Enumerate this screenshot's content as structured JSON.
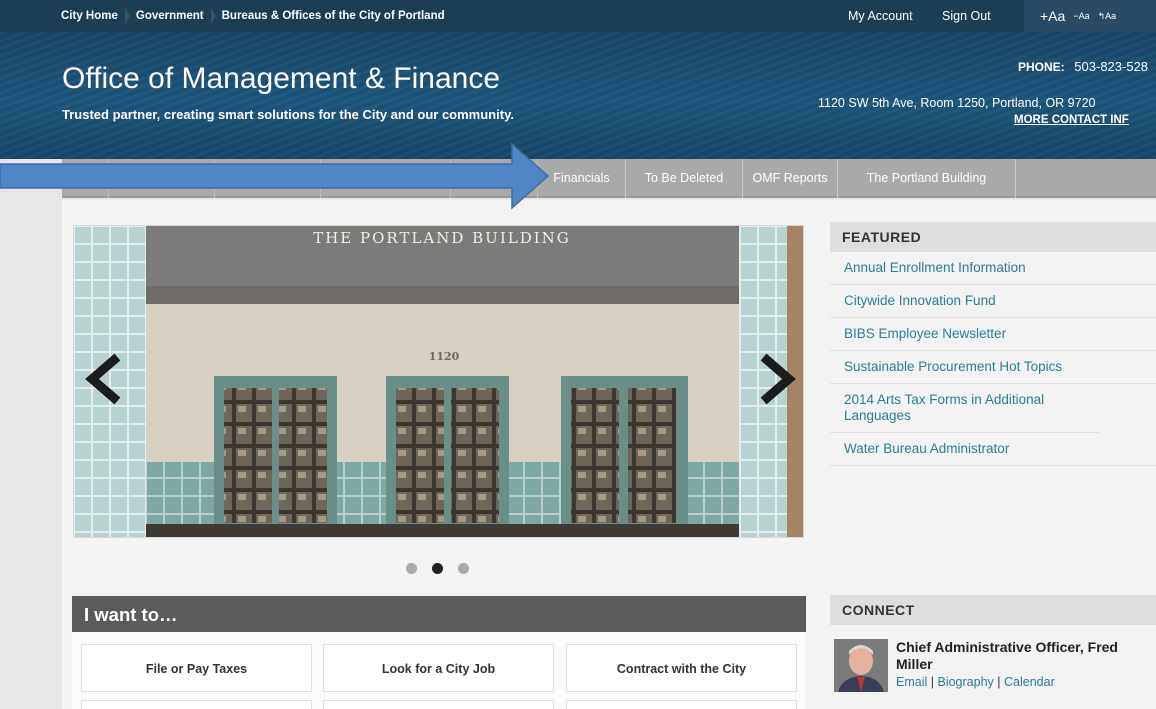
{
  "topbar": {
    "breadcrumbs": [
      "City Home",
      "Government",
      "Bureaus & Offices of the City of Portland"
    ],
    "my_account": "My Account",
    "sign_out": "Sign Out",
    "font_increase": "+Aa",
    "font_decrease": "−Aa",
    "font_reset": "↰Aa"
  },
  "header": {
    "title": "Office of Management & Finance",
    "tagline": "Trusted partner, creating smart solutions for the City and our community.",
    "phone_label": "PHONE:",
    "phone_number": "503-823-528",
    "address": "1120 SW 5th Ave, Room 1250, Portland, OR 9720",
    "contact_link": "MORE CONTACT INF"
  },
  "nav": {
    "tabs": [
      "Financials",
      "To Be Deleted",
      "OMF Reports",
      "The Portland Building"
    ]
  },
  "carousel": {
    "slide_caption": "THE PORTLAND BUILDING",
    "building_number": "1120",
    "prev_icon": "chevron-left-icon",
    "next_icon": "chevron-right-icon",
    "slide_count": 3,
    "active_slide": 2
  },
  "featured": {
    "heading": "FEATURED",
    "items": [
      "Annual Enrollment Information",
      "Citywide Innovation Fund",
      "BIBS Employee Newsletter",
      "Sustainable Procurement Hot Topics",
      "2014 Arts Tax Forms in Additional Languages",
      "Water Bureau Administrator"
    ]
  },
  "iwant": {
    "heading": "I want to…",
    "buttons": [
      "File or Pay Taxes",
      "Look for a City Job",
      "Contract with the City"
    ]
  },
  "connect": {
    "heading": "CONNECT",
    "person_name": "Chief Administrative Officer, Fred Miller",
    "links": [
      "Email",
      "Biography",
      "Calendar"
    ],
    "separator": "|"
  },
  "colors": {
    "topbar": "#1d3d53",
    "header": "#1b567d",
    "nav": "#a9a9a9",
    "link": "#2e7c93",
    "annotation_arrow": "#4f87c6"
  }
}
